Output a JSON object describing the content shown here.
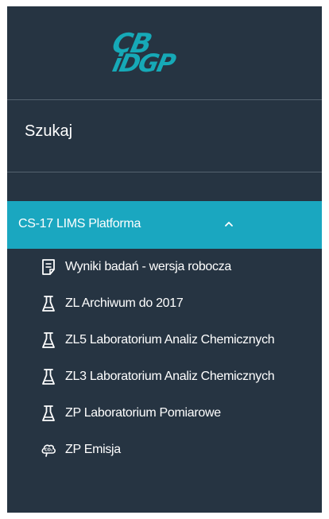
{
  "logo": {
    "line1": "CB",
    "line2": "iDGP"
  },
  "search": {
    "label": "Szukaj"
  },
  "section": {
    "label": "CS-17 LIMS Platforma",
    "chevron": "chevron-up-icon"
  },
  "nav": {
    "items": [
      {
        "label": "Wyniki badań - wersja robocza",
        "icon": "document-icon"
      },
      {
        "label": "ZL Archiwum do 2017",
        "icon": "flask-icon"
      },
      {
        "label": "ZL5 Laboratorium Analiz Chemicznych",
        "icon": "flask-icon"
      },
      {
        "label": "ZL3 Laboratorium Analiz Chemicznych",
        "icon": "flask-icon"
      },
      {
        "label": "ZP Laboratorium Pomiarowe",
        "icon": "flask-icon"
      },
      {
        "label": "ZP Emisja",
        "icon": "co2-cloud-icon"
      }
    ]
  },
  "colors": {
    "sidebar_bg": "#263442",
    "accent": "#1aa7c0",
    "logo": "#16a9b7",
    "text": "#ffffff"
  }
}
